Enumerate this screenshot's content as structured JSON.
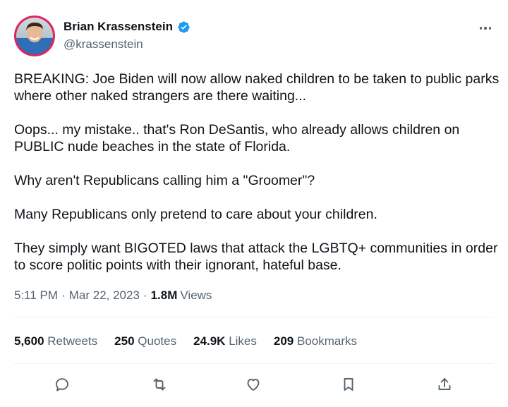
{
  "user": {
    "display_name": "Brian Krassenstein",
    "handle": "@krassenstein",
    "verified_icon": "verified-badge-icon",
    "accent_color": "#1d9bf0",
    "avatar_ring_color": "#e0245e"
  },
  "tweet": {
    "paragraphs": [
      "BREAKING: Joe Biden will now allow naked children to be taken to public parks where other naked strangers are there waiting...",
      "Oops... my mistake.. that's Ron DeSantis, who already allows children on PUBLIC nude beaches in the state of Florida.",
      "Why aren't Republicans calling him a \"Groomer\"?",
      "Many Republicans only pretend to care about your children.",
      "They simply want BIGOTED laws that attack the LGBTQ+ communities in order to score politic points with their ignorant, hateful base."
    ]
  },
  "meta": {
    "time": "5:11 PM",
    "separator": "·",
    "date": "Mar 22, 2023",
    "views_count": "1.8M",
    "views_label": "Views"
  },
  "stats": [
    {
      "count": "5,600",
      "label": "Retweets"
    },
    {
      "count": "250",
      "label": "Quotes"
    },
    {
      "count": "24.9K",
      "label": "Likes"
    },
    {
      "count": "209",
      "label": "Bookmarks"
    }
  ],
  "actions": [
    "reply-icon",
    "retweet-icon",
    "like-icon",
    "bookmark-icon",
    "share-icon"
  ],
  "more_icon": "more-options-icon"
}
